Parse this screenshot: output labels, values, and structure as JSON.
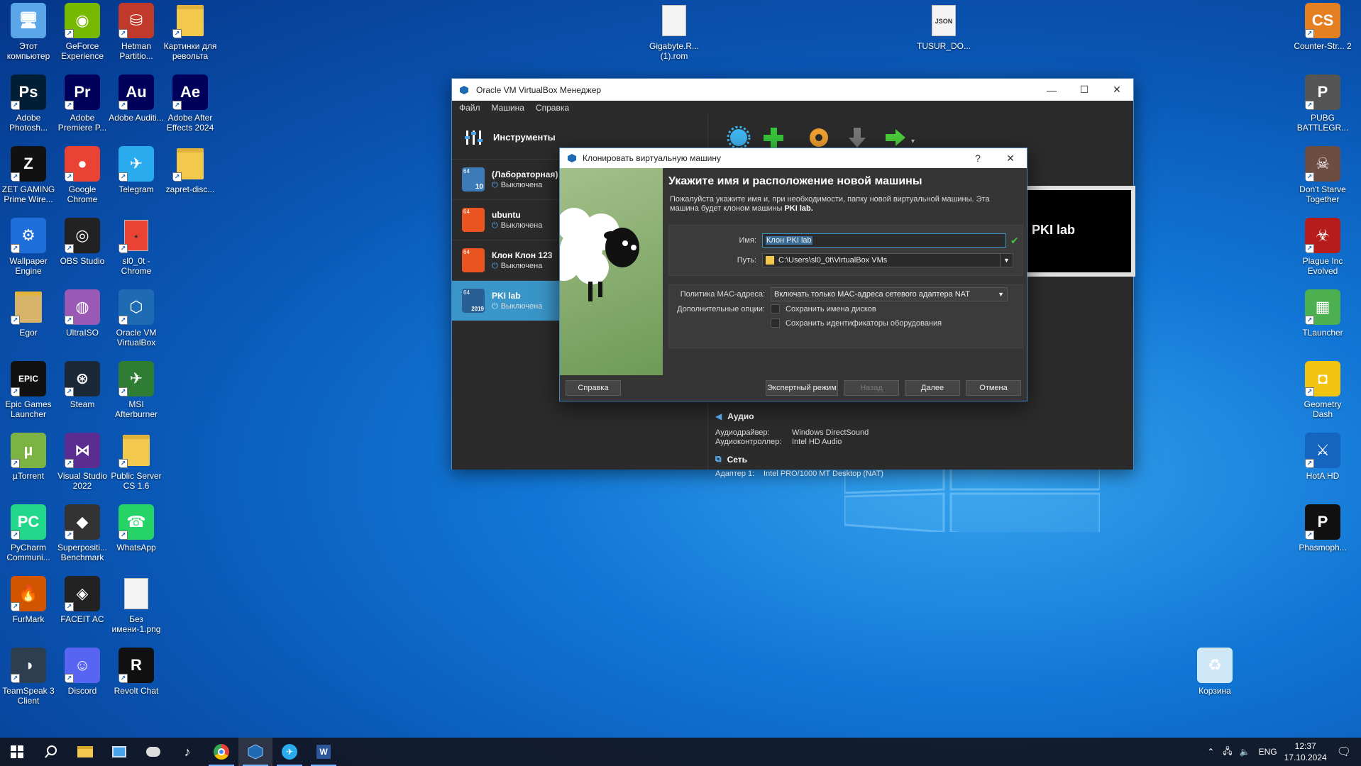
{
  "desktop": {
    "icons": [
      {
        "label": "Этот компьютер",
        "icon": "this-pc-icon",
        "color": "#5aa6e8",
        "glyph": "🖥"
      },
      {
        "label": "GeForce Experience",
        "icon": "geforce-icon",
        "color": "#76b900",
        "glyph": "◉"
      },
      {
        "label": "Hetman Partitio...",
        "icon": "hetman-icon",
        "color": "#c0392b",
        "glyph": "⛁"
      },
      {
        "label": "Картинки для револьта",
        "icon": "folder-icon",
        "color": "#f2c94c",
        "glyph": ""
      },
      {
        "label": "Adobe Photosh...",
        "icon": "photoshop-icon",
        "color": "#001e36",
        "glyph": "Ps"
      },
      {
        "label": "Adobe Premiere P...",
        "icon": "premiere-icon",
        "color": "#00005b",
        "glyph": "Pr"
      },
      {
        "label": "Adobe Auditi...",
        "icon": "audition-icon",
        "color": "#00005b",
        "glyph": "Au"
      },
      {
        "label": "Adobe After Effects 2024",
        "icon": "after-effects-icon",
        "color": "#00005b",
        "glyph": "Ae"
      },
      {
        "label": "ZET GAMING Prime Wire...",
        "icon": "zet-gaming-icon",
        "color": "#111",
        "glyph": "Z"
      },
      {
        "label": "Google Chrome",
        "icon": "chrome-icon",
        "color": "#ea4335",
        "glyph": "●"
      },
      {
        "label": "Telegram",
        "icon": "telegram-icon",
        "color": "#2aabee",
        "glyph": "✈"
      },
      {
        "label": "zapret-disc...",
        "icon": "folder-zip-icon",
        "color": "#f2c94c",
        "glyph": ""
      },
      {
        "label": "Wallpaper Engine",
        "icon": "wallpaper-engine-icon",
        "color": "#1e6fd9",
        "glyph": "⚙"
      },
      {
        "label": "OBS Studio",
        "icon": "obs-icon",
        "color": "#222",
        "glyph": "◎"
      },
      {
        "label": "sl0_0t - Chrome",
        "icon": "chrome-profile-icon",
        "color": "#ea4335",
        "glyph": "●"
      },
      {
        "label": "Egor",
        "icon": "user-folder-icon",
        "color": "#d8b46a",
        "glyph": ""
      },
      {
        "label": "UltraISO",
        "icon": "ultraiso-icon",
        "color": "#9b59b6",
        "glyph": "◍"
      },
      {
        "label": "Oracle VM VirtualBox",
        "icon": "virtualbox-icon",
        "color": "#1f6bb3",
        "glyph": "⬡"
      },
      {
        "label": "Epic Games Launcher",
        "icon": "epic-games-icon",
        "color": "#111",
        "glyph": "EPIC"
      },
      {
        "label": "Steam",
        "icon": "steam-icon",
        "color": "#1b2838",
        "glyph": "⊛"
      },
      {
        "label": "MSI Afterburner",
        "icon": "msi-afterburner-icon",
        "color": "#2e7d32",
        "glyph": "✈"
      },
      {
        "label": "µTorrent",
        "icon": "utorrent-icon",
        "color": "#7cb342",
        "glyph": "µ"
      },
      {
        "label": "Visual Studio 2022",
        "icon": "visual-studio-icon",
        "color": "#5c2d91",
        "glyph": "⋈"
      },
      {
        "label": "Public Server CS 1.6",
        "icon": "folder-icon",
        "color": "#f2c94c",
        "glyph": ""
      },
      {
        "label": "PyCharm Communi...",
        "icon": "pycharm-icon",
        "color": "#21d789",
        "glyph": "PC"
      },
      {
        "label": "Superpositi... Benchmark",
        "icon": "superposition-icon",
        "color": "#333",
        "glyph": "◆"
      },
      {
        "label": "WhatsApp",
        "icon": "whatsapp-icon",
        "color": "#25d366",
        "glyph": "☎"
      },
      {
        "label": "FurMark",
        "icon": "furmark-icon",
        "color": "#d35400",
        "glyph": "🔥"
      },
      {
        "label": "FACEIT AC",
        "icon": "faceit-icon",
        "color": "#222",
        "glyph": "◈"
      },
      {
        "label": "Без имени-1.png",
        "icon": "image-file-icon",
        "color": "#f4f4f4",
        "glyph": ""
      },
      {
        "label": "TeamSpeak 3 Client",
        "icon": "teamspeak-icon",
        "color": "#2c3e50",
        "glyph": "◑"
      },
      {
        "label": "Discord",
        "icon": "discord-icon",
        "color": "#5865f2",
        "glyph": "☺"
      },
      {
        "label": "Revolt Chat",
        "icon": "revolt-icon",
        "color": "#111",
        "glyph": "R"
      },
      {
        "label": "Gigabyte.R... (1).rom",
        "icon": "file-icon",
        "color": "#f4f4f4",
        "glyph": ""
      },
      {
        "label": "TUSUR_DO...",
        "icon": "json-file-icon",
        "color": "#f4f4f4",
        "glyph": "JSON"
      },
      {
        "label": "Counter-Str... 2",
        "icon": "cs2-icon",
        "color": "#e67e22",
        "glyph": "CS"
      },
      {
        "label": "PUBG BATTLEGR...",
        "icon": "pubg-icon",
        "color": "#555",
        "glyph": "P"
      },
      {
        "label": "Don't Starve Together",
        "icon": "dont-starve-icon",
        "color": "#6d4c41",
        "glyph": "☠"
      },
      {
        "label": "Plague Inc Evolved",
        "icon": "plague-inc-icon",
        "color": "#b71c1c",
        "glyph": "☣"
      },
      {
        "label": "TLauncher",
        "icon": "tlauncher-icon",
        "color": "#4caf50",
        "glyph": "▦"
      },
      {
        "label": "Geometry Dash",
        "icon": "geometry-dash-icon",
        "color": "#f1c40f",
        "glyph": "◘"
      },
      {
        "label": "HotA HD",
        "icon": "hota-icon",
        "color": "#1565c0",
        "glyph": "⚔"
      },
      {
        "label": "Phasmoph...",
        "icon": "phasmophobia-icon",
        "color": "#111",
        "glyph": "P"
      },
      {
        "label": "Корзина",
        "icon": "recycle-bin-icon",
        "color": "#cfe8f7",
        "glyph": "♻"
      }
    ]
  },
  "vbox": {
    "title": "Oracle VM VirtualBox Менеджер",
    "menu": [
      "Файл",
      "Машина",
      "Справка"
    ],
    "tools_label": "Инструменты",
    "vms": [
      {
        "name": "(Лабораторная)",
        "state": "Выключена",
        "badge": "10"
      },
      {
        "name": "ubuntu",
        "state": "Выключена",
        "badge": ""
      },
      {
        "name": "Клон Клон 123",
        "state": "Выключена",
        "badge": ""
      },
      {
        "name": "PKI lab",
        "state": "Выключена",
        "badge": "2019"
      }
    ],
    "preview_text": "PKI lab",
    "audio": {
      "heading": "Аудио",
      "driver_label": "Аудиодрайвер:",
      "driver_value": "Windows DirectSound",
      "controller_label": "Аудиоконтроллер:",
      "controller_value": "Intel HD Audio"
    },
    "network": {
      "heading": "Сеть",
      "adapter_label": "Адаптер 1:",
      "adapter_value": "Intel PRO/1000 MT Desktop (NAT)"
    }
  },
  "dialog": {
    "title": "Клонировать виртуальную машину",
    "help_glyph": "?",
    "heading": "Укажите имя и расположение новой машины",
    "desc_prefix": "Пожалуйста укажите имя и, при необходимости, папку новой виртуальной машины. Эта машина будет клоном машины",
    "desc_machine": "PKI lab.",
    "name_label": "Имя:",
    "name_value": "Клон PKI lab",
    "path_label": "Путь:",
    "path_value": "C:\\Users\\sl0_0t\\VirtualBox VMs",
    "mac_label": "Политика MAC-адреса:",
    "mac_value": "Включать только MAC-адреса сетевого адаптера NAT",
    "extra_label": "Дополнительные опции:",
    "opt_keep_disks": "Сохранить имена дисков",
    "opt_keep_hw": "Сохранить идентификаторы оборудования",
    "btn_help": "Справка",
    "btn_expert": "Экспертный режим",
    "btn_back": "Назад",
    "btn_next": "Далее",
    "btn_cancel": "Отмена"
  },
  "taskbar": {
    "lang": "ENG",
    "time": "12:37",
    "date": "17.10.2024"
  }
}
